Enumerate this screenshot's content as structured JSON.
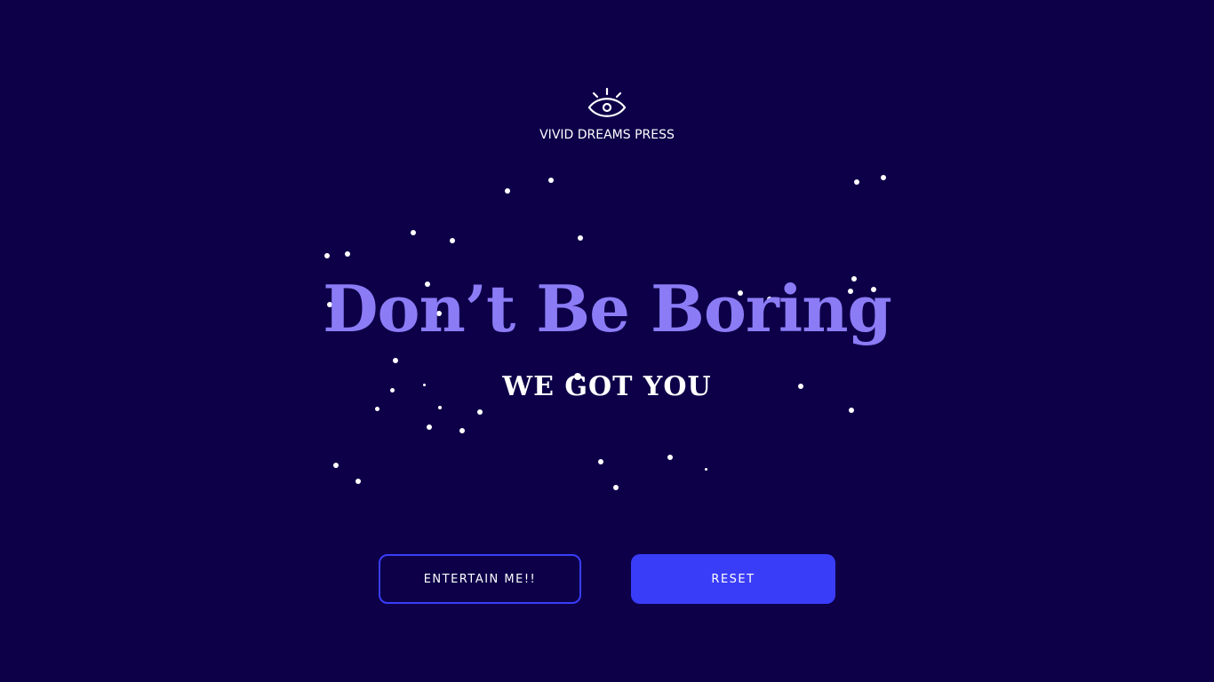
{
  "brand": {
    "name": "VIVID DREAMS PRESS",
    "icon": "eye-icon"
  },
  "hero": {
    "headline": "Don’t Be Boring",
    "subhead": "WE GOT YOU"
  },
  "buttons": {
    "entertain_label": "ENTERTAIN ME!!",
    "reset_label": "RESET"
  },
  "colors": {
    "background": "#0d0049",
    "headline": "#8b7cf6",
    "accent": "#3a3df8",
    "text": "#ffffff"
  }
}
